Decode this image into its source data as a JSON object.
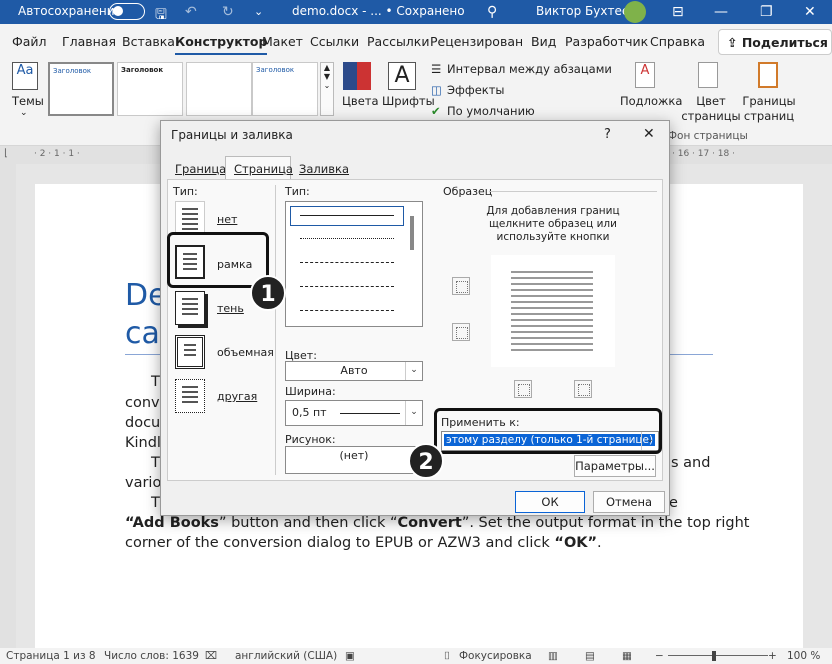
{
  "titlebar": {
    "autosave": "Автосохранение",
    "doc": "demo.docx - ... • Сохранено",
    "user": "Виктор Бухтеев"
  },
  "tabs": [
    "Файл",
    "Главная",
    "Вставка",
    "Конструктор",
    "Макет",
    "Ссылки",
    "Рассылки",
    "Рецензирование",
    "Вид",
    "Разработчик",
    "Справка"
  ],
  "share": "Поделиться",
  "ribbon": {
    "themes": "Темы",
    "style1": "Заголовок",
    "style2": "Заголовок",
    "colors": "Цвета",
    "fonts": "Шрифты",
    "spacing": "Интервал между абзацами",
    "effects": "Эффекты",
    "default": "По умолчанию",
    "watermark": "Подложка",
    "page_color": "Цвет страницы",
    "page_borders": "Границы страниц",
    "group_bg": "Фон страницы"
  },
  "ruler": {
    "left": "· 2 · 1 · 1 ·",
    "right": "· 16 · 17 · 18 ·"
  },
  "document": {
    "heading1": "De",
    "heading2": "ca",
    "line1": "T",
    "line2": "conv",
    "line3": "docu",
    "line4": "Kindl",
    "line5": "T",
    "line5b": "s and",
    "line6": "vario",
    "line7": "T",
    "line7b": "e",
    "line8a": "“Add Books",
    "line8b": "” button and then click “",
    "line8c": "Convert",
    "line8d": "”. Set the output format in the top right",
    "line9a": "corner of the conversion dialog to EPUB or AZW3 and click ",
    "line9b": "“OK”",
    "line9c": "."
  },
  "status": {
    "page": "Страница 1 из 8",
    "words": "Число слов: 1639",
    "lang": "английский (США)",
    "focus": "Фокусировка",
    "zoom": "100 %"
  },
  "dialog": {
    "title": "Границы и заливка",
    "help": "?",
    "close": "✕",
    "tabs": [
      "Граница",
      "Страница",
      "Заливка"
    ],
    "type_label": "Тип:",
    "settings": [
      "нет",
      "рамка",
      "тень",
      "объемная",
      "другая"
    ],
    "style_label": "Тип:",
    "color_label": "Цвет:",
    "color_value": "Авто",
    "width_label": "Ширина:",
    "width_value": "0,5 пт",
    "art_label": "Рисунок:",
    "art_value": "(нет)",
    "preview_label": "Образец",
    "preview_hint": "Для добавления границ щелкните образец или используйте кнопки",
    "apply_label": "Применить к:",
    "apply_value": "этому разделу (только 1-й странице)",
    "options_btn": "Параметры...",
    "ok": "ОК",
    "cancel": "Отмена"
  },
  "callouts": [
    "1",
    "2"
  ]
}
